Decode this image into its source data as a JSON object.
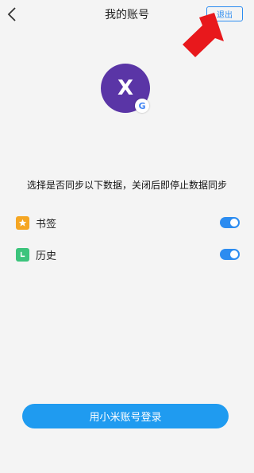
{
  "header": {
    "title": "我的账号",
    "logout_label": "退出"
  },
  "account": {
    "avatar_letter": "X",
    "avatar_color": "#5a35a6",
    "provider_badge": "G"
  },
  "sync": {
    "hint": "选择是否同步以下数据，关闭后即停止数据同步",
    "items": [
      {
        "label": "书签",
        "icon": "bookmark-star-icon",
        "icon_color": "#f5a623",
        "enabled": true
      },
      {
        "label": "历史",
        "icon": "history-clock-icon",
        "icon_color": "#3cc47c",
        "enabled": true
      }
    ]
  },
  "footer": {
    "login_label": "用小米账号登录"
  },
  "colors": {
    "accent": "#2c8cf0",
    "annotation_arrow": "#e8181c"
  }
}
